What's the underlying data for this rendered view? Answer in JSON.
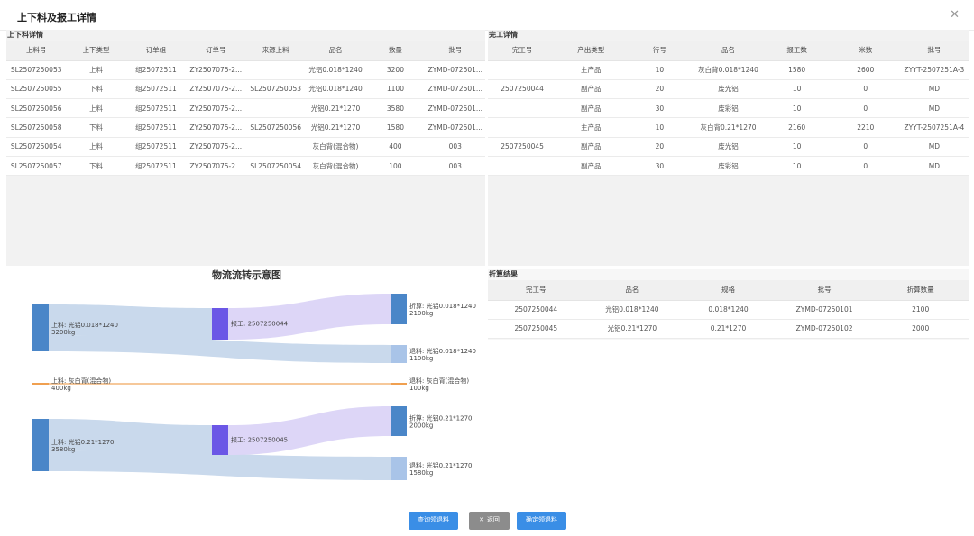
{
  "dialog": {
    "title": "上下料及报工详情",
    "close_icon": "close-icon"
  },
  "material": {
    "title": "上下料详情",
    "columns": [
      "上料号",
      "上下类型",
      "订单组",
      "订单号",
      "来源上料",
      "品名",
      "数量",
      "批号"
    ],
    "rows": [
      [
        "SL2507250053",
        "上料",
        "组25072511",
        "ZY2507075-2...",
        "",
        "光铝0.018*1240",
        "3200",
        "ZYMD-072501..."
      ],
      [
        "SL2507250055",
        "下料",
        "组25072511",
        "ZY2507075-2...",
        "SL2507250053",
        "光铝0.018*1240",
        "1100",
        "ZYMD-072501..."
      ],
      [
        "SL2507250056",
        "上料",
        "组25072511",
        "ZY2507075-2...",
        "",
        "光铝0.21*1270",
        "3580",
        "ZYMD-072501..."
      ],
      [
        "SL2507250058",
        "下料",
        "组25072511",
        "ZY2507075-2...",
        "SL2507250056",
        "光铝0.21*1270",
        "1580",
        "ZYMD-072501..."
      ],
      [
        "SL2507250054",
        "上料",
        "组25072511",
        "ZY2507075-2...",
        "",
        "灰白背(混合物)",
        "400",
        "003"
      ],
      [
        "SL2507250057",
        "下料",
        "组25072511",
        "ZY2507075-2...",
        "SL2507250054",
        "灰白背(混合物)",
        "100",
        "003"
      ]
    ]
  },
  "completion": {
    "title": "完工详情",
    "columns": [
      "完工号",
      "产出类型",
      "行号",
      "品名",
      "报工数",
      "米数",
      "批号"
    ],
    "rows": [
      [
        "",
        "主产品",
        "10",
        "灰白背0.018*1240",
        "1580",
        "2600",
        "ZYYT-2507251A-3"
      ],
      [
        "2507250044",
        "副产品",
        "20",
        "废光铝",
        "10",
        "0",
        "MD"
      ],
      [
        "",
        "副产品",
        "30",
        "废彩铝",
        "10",
        "0",
        "MD"
      ],
      [
        "",
        "主产品",
        "10",
        "灰白背0.21*1270",
        "2160",
        "2210",
        "ZYYT-2507251A-4"
      ],
      [
        "2507250045",
        "副产品",
        "20",
        "废光铝",
        "10",
        "0",
        "MD"
      ],
      [
        "",
        "副产品",
        "30",
        "废彩铝",
        "10",
        "0",
        "MD"
      ]
    ]
  },
  "settlement": {
    "title": "折算结果",
    "columns": [
      "完工号",
      "品名",
      "规格",
      "批号",
      "折算数量"
    ],
    "rows": [
      [
        "2507250044",
        "光铝0.018*1240",
        "0.018*1240",
        "ZYMD-07250101",
        "2100"
      ],
      [
        "2507250045",
        "光铝0.21*1270",
        "0.21*1270",
        "ZYMD-07250102",
        "2000"
      ]
    ]
  },
  "sankey": {
    "title": "物流流转示意图",
    "colors": {
      "source": "#4a86c8",
      "process": "#6b57e6",
      "converted": "#4a86c8",
      "return": "#a9c4e8",
      "mixed": "#f0a050",
      "link": "#c9d9ec",
      "link_violet": "#ddd6f7"
    },
    "nodes": [
      {
        "name": "上料: 光铝0.018*1240",
        "value": "3200kg"
      },
      {
        "name": "报工: 2507250044"
      },
      {
        "name": "折算: 光铝0.018*1240",
        "value": "2100kg"
      },
      {
        "name": "退料: 光铝0.018*1240",
        "value": "1100kg"
      },
      {
        "name": "上料: 灰白背(混合物)",
        "value": "400kg"
      },
      {
        "name": "退料: 灰白背(混合物)",
        "value": "100kg"
      },
      {
        "name": "上料: 光铝0.21*1270",
        "value": "3580kg"
      },
      {
        "name": "报工: 2507250045"
      },
      {
        "name": "折算: 光铝0.21*1270",
        "value": "2000kg"
      },
      {
        "name": "退料: 光铝0.21*1270",
        "value": "1580kg"
      }
    ]
  },
  "buttons": {
    "query": "查询领退料",
    "back": "返回",
    "back_icon": "close-icon",
    "confirm": "确定领退料"
  }
}
